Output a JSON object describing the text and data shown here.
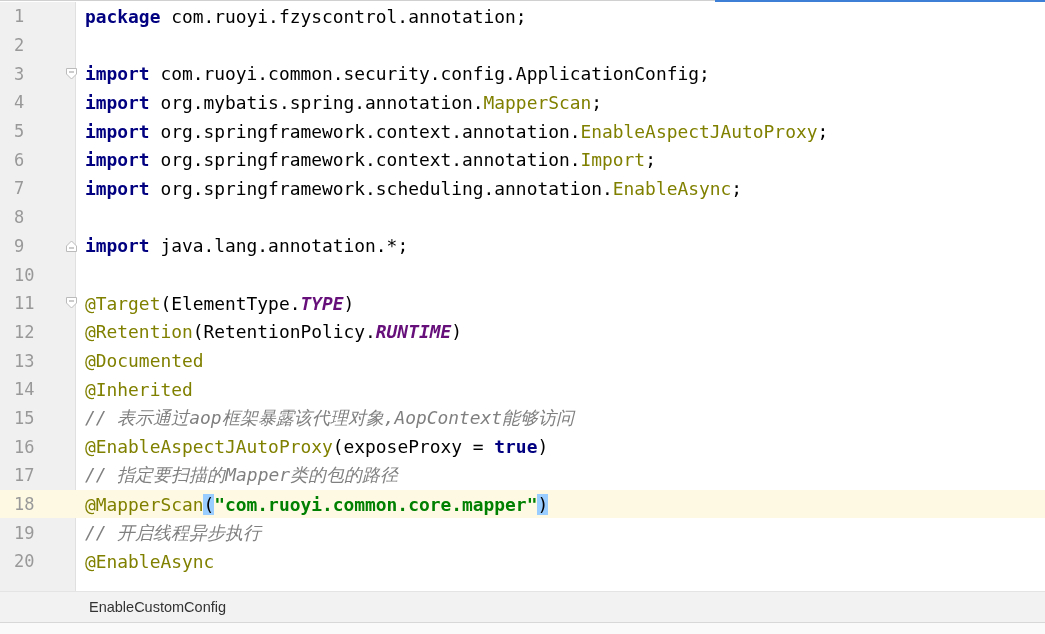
{
  "editor": {
    "lines": [
      {
        "number": "1",
        "current": false,
        "kind": "code",
        "tokens": [
          {
            "kind": "keyword",
            "text": "package"
          },
          {
            "kind": "plain",
            "text": " com.ruoyi.fzyscontrol.annotation;"
          }
        ]
      },
      {
        "number": "2",
        "current": false,
        "kind": "code"
      },
      {
        "number": "3",
        "current": false,
        "kind": "fold_start",
        "tokens": [
          {
            "kind": "keyword",
            "text": "import"
          },
          {
            "kind": "plain",
            "text": " com.ruoyi.common.security.config.ApplicationConfig;"
          }
        ]
      },
      {
        "number": "4",
        "current": false,
        "kind": "code",
        "tokens": [
          {
            "kind": "keyword",
            "text": "import"
          },
          {
            "kind": "plain",
            "text": " org.mybatis.spring.annotation."
          },
          {
            "kind": "annotation",
            "text": "MapperScan"
          },
          {
            "kind": "plain",
            "text": ";"
          }
        ]
      },
      {
        "number": "5",
        "current": false,
        "kind": "code",
        "tokens": [
          {
            "kind": "keyword",
            "text": "import"
          },
          {
            "kind": "plain",
            "text": " org.springframework.context.annotation."
          },
          {
            "kind": "annotation",
            "text": "EnableAspectJAutoProxy"
          },
          {
            "kind": "plain",
            "text": ";"
          }
        ]
      },
      {
        "number": "6",
        "current": false,
        "kind": "code",
        "tokens": [
          {
            "kind": "keyword",
            "text": "import"
          },
          {
            "kind": "plain",
            "text": " org.springframework.context.annotation."
          },
          {
            "kind": "annotation",
            "text": "Import"
          },
          {
            "kind": "plain",
            "text": ";"
          }
        ]
      },
      {
        "number": "7",
        "current": false,
        "kind": "code",
        "tokens": [
          {
            "kind": "keyword",
            "text": "import"
          },
          {
            "kind": "plain",
            "text": " org.springframework.scheduling.annotation."
          },
          {
            "kind": "annotation",
            "text": "EnableAsync"
          },
          {
            "kind": "plain",
            "text": ";"
          }
        ]
      },
      {
        "number": "8",
        "current": false,
        "kind": "code"
      },
      {
        "number": "9",
        "current": false,
        "kind": "fold_end",
        "tokens": [
          {
            "kind": "keyword",
            "text": "import"
          },
          {
            "kind": "plain",
            "text": " java.lang.annotation.*;"
          }
        ]
      },
      {
        "number": "10",
        "current": false,
        "kind": "code"
      },
      {
        "number": "11",
        "current": false,
        "kind": "fold_start",
        "tokens": [
          {
            "kind": "annotation",
            "text": "@Target"
          },
          {
            "kind": "plain",
            "text": "(ElementType."
          },
          {
            "kind": "constant",
            "text": "TYPE"
          },
          {
            "kind": "plain",
            "text": ")"
          }
        ]
      },
      {
        "number": "12",
        "current": false,
        "kind": "code",
        "tokens": [
          {
            "kind": "annotation",
            "text": "@Retention"
          },
          {
            "kind": "plain",
            "text": "(RetentionPolicy."
          },
          {
            "kind": "constant",
            "text": "RUNTIME"
          },
          {
            "kind": "plain",
            "text": ")"
          }
        ]
      },
      {
        "number": "13",
        "current": false,
        "kind": "code",
        "tokens": [
          {
            "kind": "annotation",
            "text": "@Documented"
          }
        ]
      },
      {
        "number": "14",
        "current": false,
        "kind": "code",
        "tokens": [
          {
            "kind": "annotation",
            "text": "@Inherited"
          }
        ]
      },
      {
        "number": "15",
        "current": false,
        "kind": "code",
        "tokens": [
          {
            "kind": "comment",
            "text": "// 表示通过aop框架暴露该代理对象,AopContext能够访问"
          }
        ]
      },
      {
        "number": "16",
        "current": false,
        "kind": "code",
        "tokens": [
          {
            "kind": "annotation",
            "text": "@EnableAspectJAutoProxy"
          },
          {
            "kind": "plain",
            "text": "(exposeProxy = "
          },
          {
            "kind": "keyword",
            "text": "true"
          },
          {
            "kind": "plain",
            "text": ")"
          }
        ]
      },
      {
        "number": "17",
        "current": false,
        "kind": "code",
        "tokens": [
          {
            "kind": "comment",
            "text": "// 指定要扫描的Mapper类的包的路径"
          }
        ]
      },
      {
        "number": "18",
        "current": true,
        "kind": "code",
        "tokens": [
          {
            "kind": "annotation",
            "text": "@MapperScan"
          },
          {
            "kind": "bracket_match",
            "text": "("
          },
          {
            "kind": "string",
            "text": "\"com.ruoyi.common.core.mapper\""
          },
          {
            "kind": "bracket_match",
            "text": ")"
          }
        ]
      },
      {
        "number": "19",
        "current": false,
        "kind": "code",
        "tokens": [
          {
            "kind": "comment",
            "text": "// 开启线程异步执行"
          }
        ]
      },
      {
        "number": "20",
        "current": false,
        "kind": "code",
        "tokens": [
          {
            "kind": "annotation",
            "text": "@EnableAsync"
          }
        ]
      }
    ]
  },
  "breadcrumb": {
    "label": "EnableCustomConfig"
  }
}
